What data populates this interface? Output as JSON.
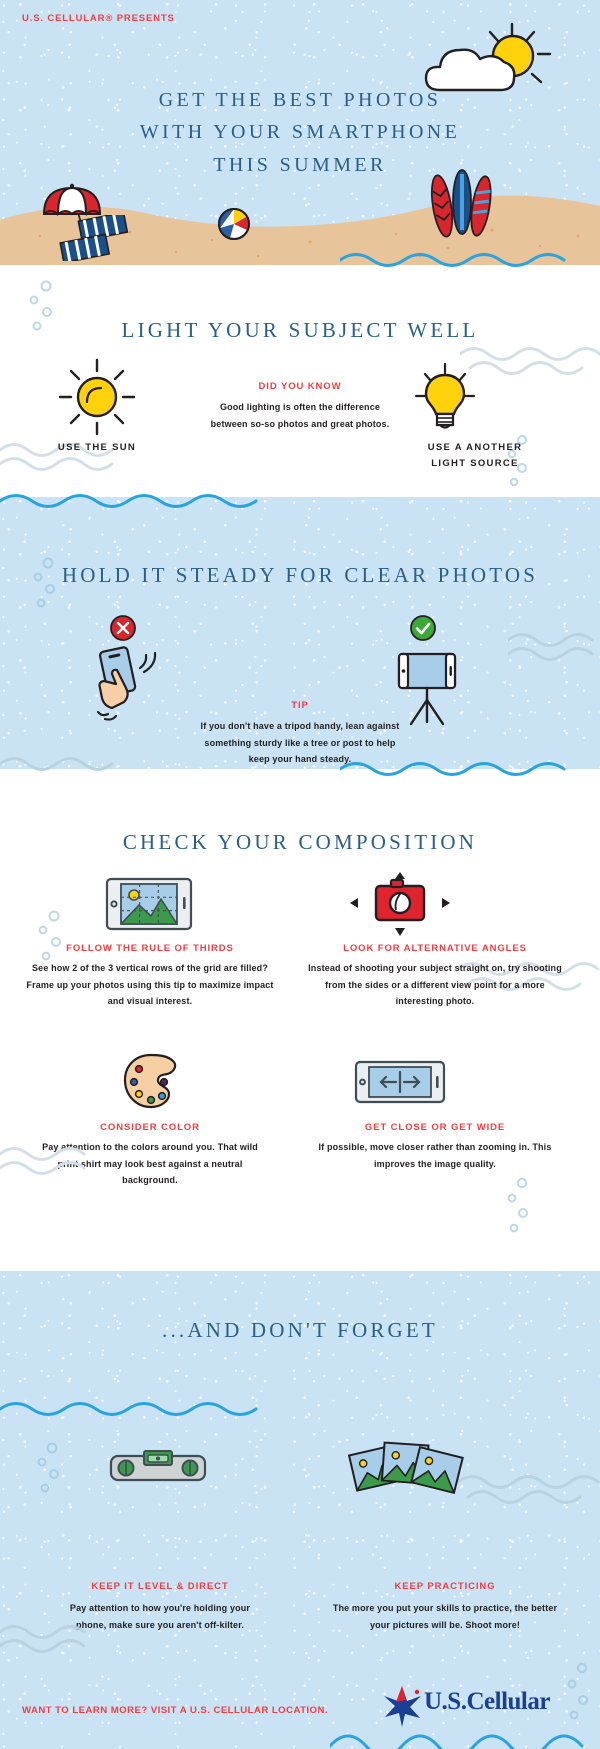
{
  "header": {
    "presents": "U.S. CELLULAR® PRESENTS",
    "title_line1": "GET THE BEST PHOTOS",
    "title_line2": "WITH YOUR SMARTPHONE",
    "title_line3": "THIS SUMMER",
    "icons": [
      "sun-icon",
      "cloud-icon",
      "beach-umbrella-icon",
      "beach-towel-icon",
      "beach-ball-icon",
      "surfboard-icon"
    ]
  },
  "section_light": {
    "title": "LIGHT YOUR SUBJECT WELL",
    "left": {
      "icon": "sun-icon",
      "label": "USE THE SUN"
    },
    "center": {
      "eyebrow": "DID YOU KNOW",
      "body": "Good lighting is often the difference between so-so photos and great photos."
    },
    "right": {
      "icon": "lightbulb-icon",
      "label_line1": "USE A ANOTHER",
      "label_line2": "LIGHT SOURCE"
    }
  },
  "section_steady": {
    "title": "HOLD IT STEADY FOR CLEAR PHOTOS",
    "left": {
      "badge": "x-mark-icon",
      "icon": "handheld-phone-shake-icon"
    },
    "center": {
      "eyebrow": "TIP",
      "body": "If you don't have a tripod handy, lean against something sturdy like a tree or post to help keep your hand steady."
    },
    "right": {
      "badge": "check-mark-icon",
      "icon": "phone-on-tripod-icon"
    }
  },
  "section_composition": {
    "title": "CHECK YOUR COMPOSITION",
    "tips": [
      {
        "icon": "phone-grid-photo-icon",
        "heading": "FOLLOW THE RULE OF THIRDS",
        "body": "See how 2 of the 3 vertical rows of the grid are filled? Frame up your photos using this tip to maximize impact and visual interest."
      },
      {
        "icon": "camera-angles-icon",
        "heading": "LOOK FOR ALTERNATIVE ANGLES",
        "body": "Instead of shooting your subject straight on, try shooting from the sides or a different view point for a more interesting photo."
      },
      {
        "icon": "paint-palette-icon",
        "heading": "CONSIDER COLOR",
        "body": "Pay attention to the colors around you. That wild print shirt may look best against a neutral background."
      },
      {
        "icon": "phone-zoom-arrows-icon",
        "heading": "GET CLOSE OR GET WIDE",
        "body": "If possible, move closer rather than zooming in. This improves the image quality."
      }
    ]
  },
  "section_forget": {
    "title": "...AND DON'T FORGET",
    "tips": [
      {
        "icon": "spirit-level-icon",
        "heading": "KEEP IT LEVEL & DIRECT",
        "body": "Pay attention to how you're holding your phone, make sure you aren't off-kilter."
      },
      {
        "icon": "photo-stack-icon",
        "heading": "KEEP PRACTICING",
        "body": "The more you put your skills to practice, the better your pictures will be. Shoot more!"
      }
    ]
  },
  "footer": {
    "cta": "WANT TO LEARN MORE? VISIT A U.S. CELLULAR LOCATION.",
    "logo_text_1": "U.S.",
    "logo_text_2": "Cellular",
    "logo_icon": "us-cellular-star-icon"
  },
  "colors": {
    "sky": "#c9e3f4",
    "sand": "#e8c49a",
    "red": "#ef3e42",
    "navy": "#2a5f86",
    "yellow": "#fdd20a",
    "wave_blue": "#2aa3de",
    "wave_grey": "#ccd9e3",
    "logo_blue": "#1b3f94"
  }
}
